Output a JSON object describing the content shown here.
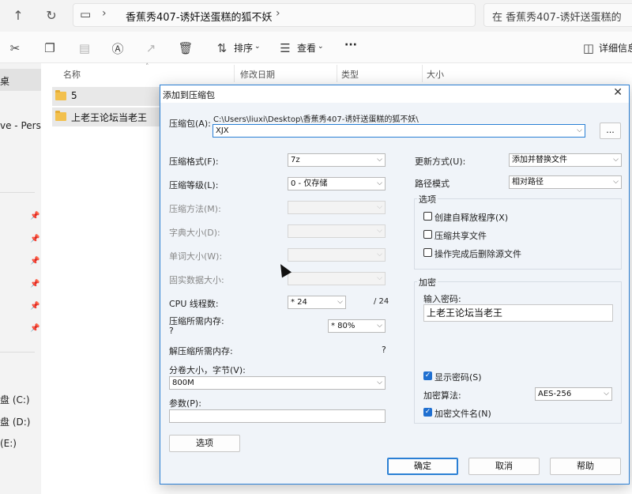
{
  "explorer": {
    "address_path": "香蕉秀407-诱奸送蛋糕的狐不妖",
    "search_placeholder": "在 香蕉秀407-诱奸送蛋糕的",
    "toolbar": {
      "sort_label": "排序",
      "view_label": "查看",
      "more_label": "···",
      "details_label": "详细信息"
    },
    "left_pane": {
      "items": [
        "桌",
        "",
        "ve - Person"
      ],
      "drives": [
        "盘 (C:)",
        "盘 (D:)",
        "(E:)"
      ]
    },
    "columns": [
      "名称",
      "修改日期",
      "类型",
      "大小"
    ],
    "files": [
      "5",
      "上老王论坛当老王"
    ]
  },
  "dialog": {
    "title": "添加到压缩包",
    "archive_label": "压缩包(A):",
    "archive_path": "C:\\Users\\liuxi\\Desktop\\香蕉秀407-诱奸送蛋糕的狐不妖\\",
    "archive_name": "XJX",
    "browse_label": "...",
    "format_label": "压缩格式(F):",
    "format_value": "7z",
    "level_label": "压缩等级(L):",
    "level_value": "0 - 仅存储",
    "method_label": "压缩方法(M):",
    "dict_label": "字典大小(D):",
    "word_label": "单词大小(W):",
    "solid_label": "固实数据大小:",
    "cpu_label": "CPU 线程数:",
    "cpu_value": "* 24",
    "cpu_total": "/ 24",
    "mem_label": "压缩所需内存:",
    "mem_q": "?",
    "mem_value": "* 80%",
    "decomp_label": "解压缩所需内存:",
    "decomp_value": "?",
    "split_label": "分卷大小，字节(V):",
    "split_value": "800M",
    "params_label": "参数(P):",
    "params_value": "",
    "options_button": "选项",
    "update_label": "更新方式(U):",
    "update_value": "添加并替换文件",
    "path_mode_label": "路径模式",
    "path_mode_value": "相对路径",
    "options_group": "选项",
    "opt_sfx": "创建自释放程序(X)",
    "opt_shared": "压缩共享文件",
    "opt_delete": "操作完成后删除源文件",
    "encrypt_group": "加密",
    "password_label": "输入密码:",
    "password_value": "上老王论坛当老王",
    "show_password": "显示密码(S)",
    "enc_method_label": "加密算法:",
    "enc_method_value": "AES-256",
    "encrypt_names": "加密文件名(N)",
    "ok_button": "确定",
    "cancel_button": "取消",
    "help_button": "帮助"
  }
}
